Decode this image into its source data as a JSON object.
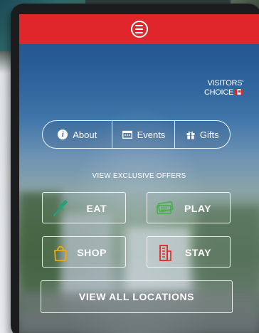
{
  "header": {
    "menu_icon": "hamburger-menu-icon",
    "bar_color": "#e0262b"
  },
  "logo": {
    "line1": "VISITORS'",
    "line2": "CHOICE",
    "flag_icon": "canada-flag-icon"
  },
  "nav": {
    "items": [
      {
        "label": "About",
        "icon": "info-icon"
      },
      {
        "label": "Events",
        "icon": "calendar-icon"
      },
      {
        "label": "Gifts",
        "icon": "gift-icon"
      }
    ]
  },
  "offers": {
    "heading": "VIEW EXCLUSIVE OFFERS",
    "buttons": [
      {
        "label": "EAT",
        "icon": "fork-icon",
        "icon_color": "#1fa37a"
      },
      {
        "label": "PLAY",
        "icon": "tickets-icon",
        "icon_color": "#4caf50"
      },
      {
        "label": "SHOP",
        "icon": "shopping-bag-icon",
        "icon_color": "#f2a900"
      },
      {
        "label": "STAY",
        "icon": "hotel-building-icon",
        "icon_color": "#e0262b"
      }
    ],
    "view_all_label": "VIEW ALL LOCATIONS"
  }
}
